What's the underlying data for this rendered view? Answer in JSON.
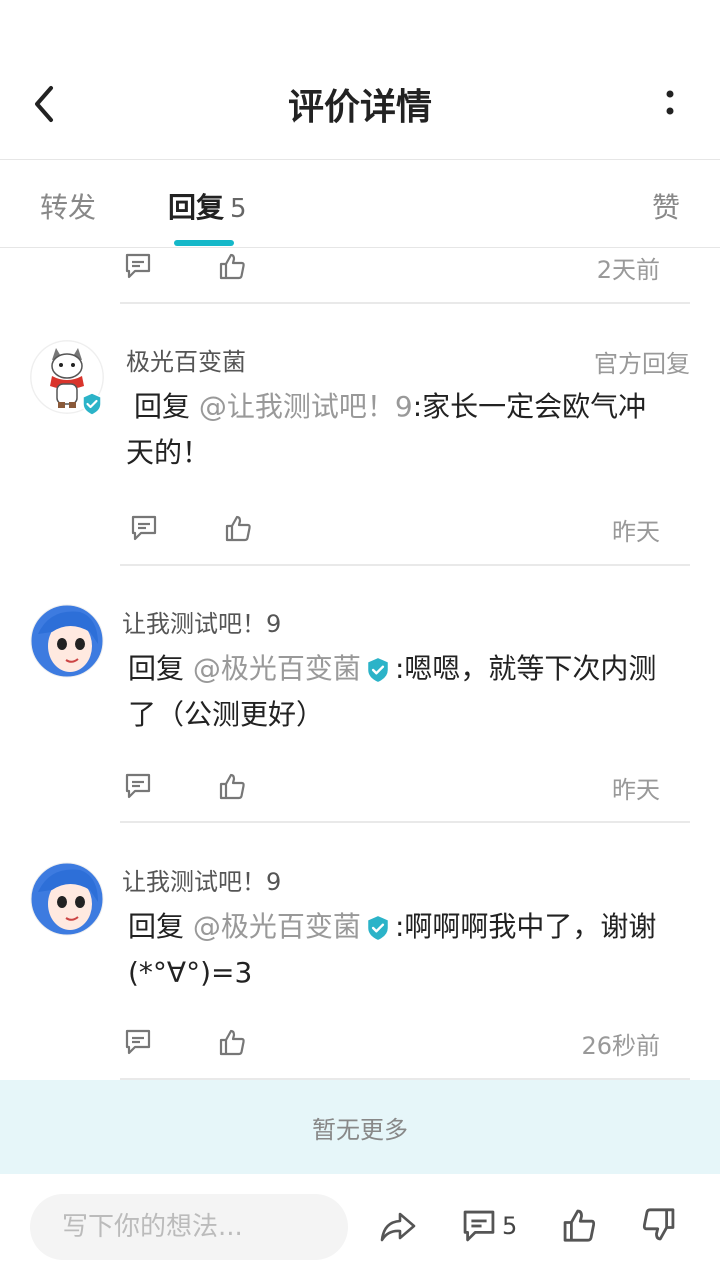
{
  "header": {
    "title": "评价详情"
  },
  "tabs": {
    "forward": "转发",
    "reply": "回复",
    "reply_count": "5",
    "like": "赞"
  },
  "top_partial": {
    "time": "2天前"
  },
  "replies": [
    {
      "name": "极光百变菌",
      "official": "官方回复",
      "prefix": "回复",
      "mention": "@让我测试吧！9",
      "text": ":家长一定会欧气冲天的！",
      "time": "昨天"
    },
    {
      "name": "让我测试吧！9",
      "prefix": "回复",
      "mention": "@极光百变菌",
      "text": ":嗯嗯，就等下次内测了（公测更好）",
      "time": "昨天"
    },
    {
      "name": "让我测试吧！9",
      "prefix": "回复",
      "mention": "@极光百变菌",
      "text": ":啊啊啊我中了，谢谢(*°∀°)=3",
      "time": "26秒前"
    }
  ],
  "footer": {
    "no_more": "暂无更多"
  },
  "bottom_bar": {
    "input_placeholder": "写下你的想法...",
    "comment_count": "5"
  },
  "colors": {
    "accent": "#15b8c9",
    "verified": "#2bb3c8"
  }
}
